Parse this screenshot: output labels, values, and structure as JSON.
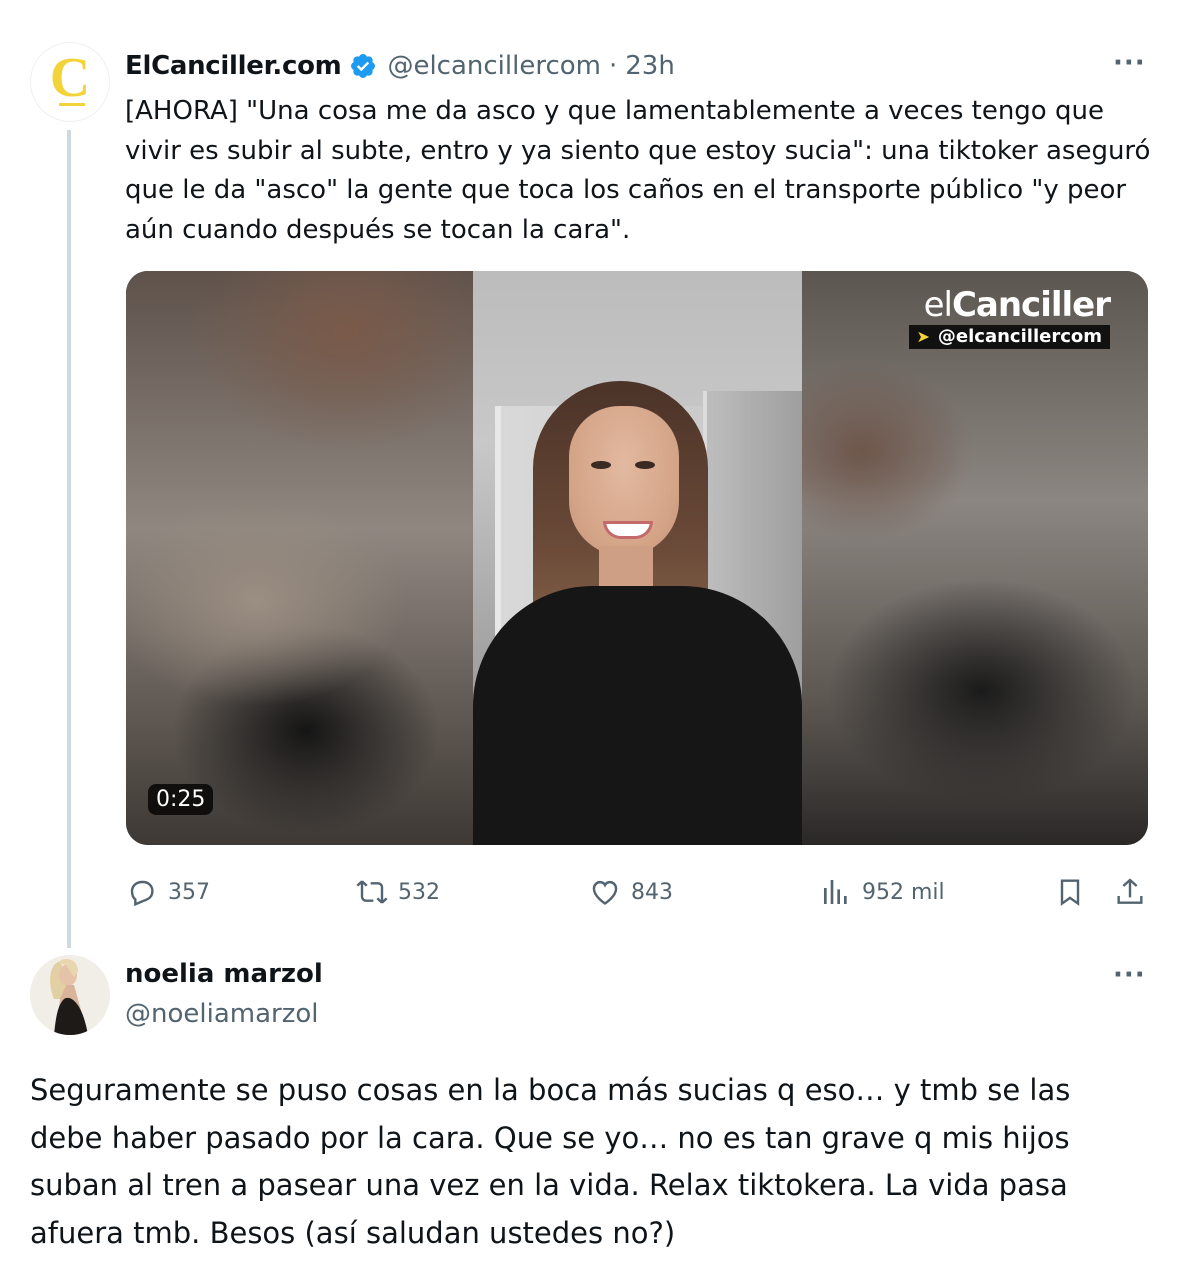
{
  "tweet": {
    "author_name": "ElCanciller.com",
    "author_handle": "@elcancillercom",
    "separator": "·",
    "time": "23h",
    "avatar_letter": "C",
    "more_label": "···",
    "text": "[AHORA] \"Una cosa me da asco y que lamentablemente a veces tengo que vivir es subir al subte, entro y ya siento que estoy sucia\": una tiktoker aseguró que le da \"asco\" la gente que toca los caños en el transporte público \"y peor aún cuando después se tocan la cara\".",
    "video": {
      "duration": "0:25",
      "watermark_prefix": "el",
      "watermark_bold": "Canciller",
      "watermark_handle": "@elcancillercom"
    },
    "stats": {
      "replies": "357",
      "retweets": "532",
      "likes": "843",
      "views": "952 mil"
    }
  },
  "reply": {
    "author_name": "noelia marzol",
    "author_handle": "@noeliamarzol",
    "more_label": "···",
    "text": "Seguramente se puso cosas en la boca más sucias q eso… y tmb se las debe haber pasado por la cara. Que se yo… no es tan grave q mis hijos suban al tren a pasear una vez en la vida. Relax tiktokera. La vida pasa afuera tmb. Besos (así saludan ustedes no?)"
  },
  "colors": {
    "verified": "#1d9bf0",
    "text_secondary": "#536471",
    "thread_line": "#cfd9de",
    "brand_yellow": "#f2d43a"
  }
}
